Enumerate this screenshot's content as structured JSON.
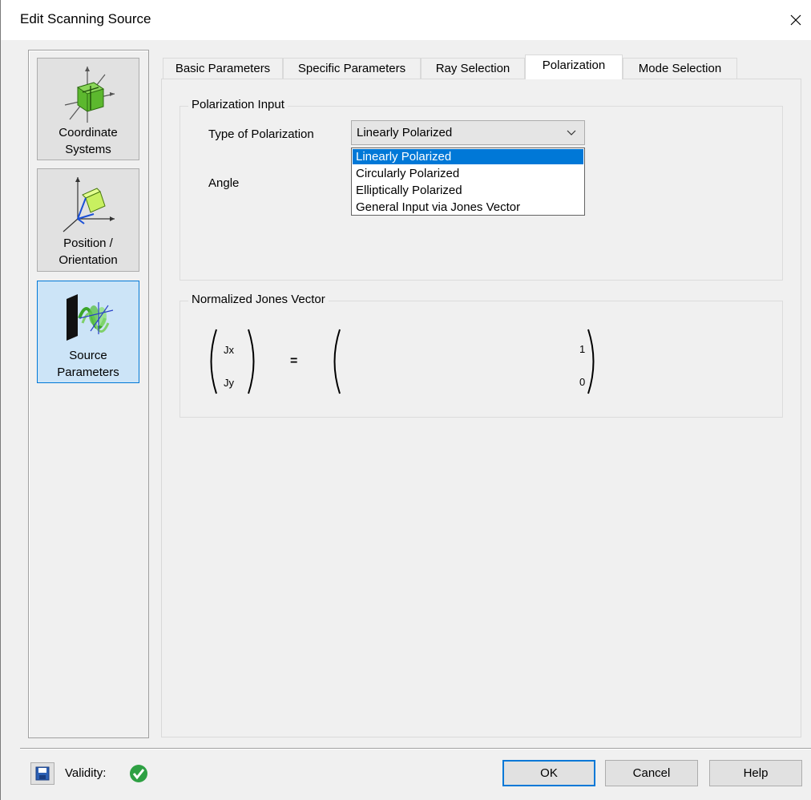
{
  "window": {
    "title": "Edit Scanning Source",
    "close_icon": "close-icon"
  },
  "nav": {
    "items": [
      {
        "label_line1": "Coordinate",
        "label_line2": "Systems",
        "icon": "coordinate-systems-icon"
      },
      {
        "label_line1": "Position /",
        "label_line2": "Orientation",
        "icon": "position-orientation-icon"
      },
      {
        "label_line1": "Source",
        "label_line2": "Parameters",
        "icon": "source-parameters-icon",
        "selected": true
      }
    ]
  },
  "tabs": [
    {
      "label": "Basic Parameters"
    },
    {
      "label": "Specific Parameters"
    },
    {
      "label": "Ray Selection"
    },
    {
      "label": "Polarization",
      "active": true
    },
    {
      "label": "Mode Selection"
    }
  ],
  "polarization_input": {
    "title": "Polarization Input",
    "type_label": "Type of Polarization",
    "type_value": "Linearly Polarized",
    "angle_label": "Angle",
    "options": [
      "Linearly Polarized",
      "Circularly Polarized",
      "Elliptically Polarized",
      "General Input via Jones Vector"
    ],
    "highlighted_option": "Linearly Polarized"
  },
  "jones_vector": {
    "title": "Normalized Jones Vector",
    "jx_label": "Jx",
    "jy_label": "Jy",
    "equals": "=",
    "value_x": "1",
    "value_y": "0"
  },
  "footer": {
    "save_icon": "save-icon",
    "validity_label": "Validity:",
    "validity_icon": "valid-check-icon",
    "ok_label": "OK",
    "cancel_label": "Cancel",
    "help_label": "Help"
  },
  "colors": {
    "accent": "#0078d7",
    "valid_green": "#2ea043"
  }
}
